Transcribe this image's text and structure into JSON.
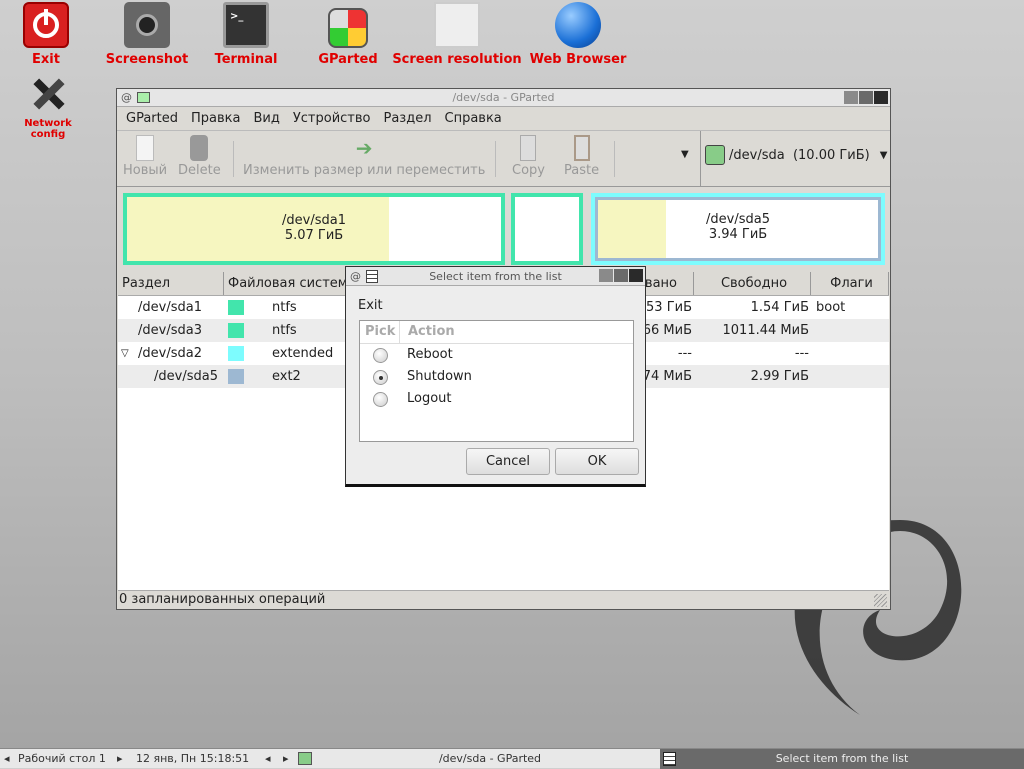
{
  "desktop": {
    "icons": [
      {
        "label": "Exit",
        "icon": "power-icon"
      },
      {
        "label": "Screenshot",
        "icon": "camera-icon"
      },
      {
        "label": "Terminal",
        "icon": "terminal-icon"
      },
      {
        "label": "GParted",
        "icon": "gparted-icon"
      },
      {
        "label": "Screen resolution",
        "icon": "monitor-icon"
      },
      {
        "label": "Web Browser",
        "icon": "globe-icon"
      },
      {
        "label": "Network config",
        "icon": "tools-icon"
      }
    ]
  },
  "window": {
    "title": "/dev/sda - GParted",
    "menu": [
      "GParted",
      "Правка",
      "Вид",
      "Устройство",
      "Раздел",
      "Справка"
    ],
    "toolbar": {
      "new": "Новый",
      "delete": "Delete",
      "resize": "Изменить размер или переместить",
      "copy": "Copy",
      "paste": "Paste",
      "device": "/dev/sda  (10.00 ГиБ)"
    },
    "diskmap": {
      "sda1_name": "/dev/sda1",
      "sda1_size": "5.07 ГиБ",
      "sda5_name": "/dev/sda5",
      "sda5_size": "3.94 ГиБ"
    },
    "columns": [
      "Раздел",
      "Файловая систем",
      "вано",
      "Свободно",
      "Флаги"
    ],
    "rows": [
      {
        "partition": "/dev/sda1",
        "fs": "ntfs",
        "color": "#42e5ac",
        "used": "53 ГиБ",
        "free": "1.54 ГиБ",
        "flags": "boot"
      },
      {
        "partition": "/dev/sda3",
        "fs": "ntfs",
        "color": "#42e5ac",
        "used": "66 МиБ",
        "free": "1011.44 МиБ",
        "flags": ""
      },
      {
        "partition": "/dev/sda2",
        "fs": "extended",
        "color": "#7dfcfe",
        "used": "---",
        "free": "---",
        "flags": ""
      },
      {
        "partition": "/dev/sda5",
        "fs": "ext2",
        "color": "#9db8d2",
        "used": "74 МиБ",
        "free": "2.99 ГиБ",
        "flags": ""
      }
    ],
    "status": "0 запланированных операций"
  },
  "dialog": {
    "title": "Select item from the list",
    "prompt": "Exit",
    "col_pick": "Pick",
    "col_action": "Action",
    "items": [
      {
        "label": "Reboot",
        "selected": false
      },
      {
        "label": "Shutdown",
        "selected": true
      },
      {
        "label": "Logout",
        "selected": false
      }
    ],
    "cancel": "Cancel",
    "ok": "OK"
  },
  "taskbar": {
    "desktop": "Рабочий стол 1",
    "clock": "12 янв, Пн 15:18:51",
    "task1": "/dev/sda - GParted",
    "task2": "Select item from the list"
  }
}
